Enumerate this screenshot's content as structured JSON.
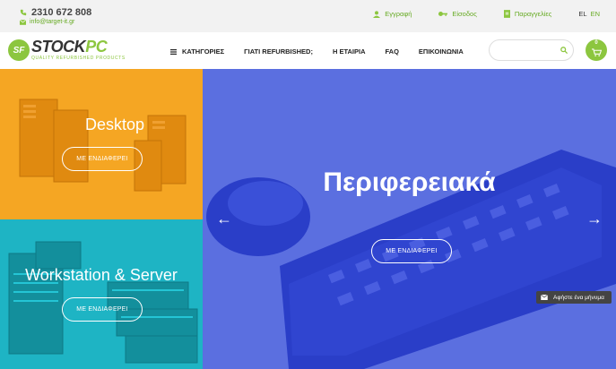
{
  "topbar": {
    "phone": "2310 672 808",
    "email": "info@target-it.gr",
    "register": "Εγγραφή",
    "login": "Είσοδος",
    "orders": "Παραγγελίες",
    "lang_el": "EL",
    "lang_en": "EN"
  },
  "logo": {
    "part1": "STOCK",
    "part2": "PC",
    "tagline": "QUALITY REFURBISHED PRODUCTS",
    "mark": "SF"
  },
  "nav": {
    "categories": "ΚΑΤΗΓΟΡΙΕΣ",
    "why": "ΓΙΑΤΙ REFURBISHED;",
    "company": "Η ΕΤΑΙΡΙΑ",
    "faq": "FAQ",
    "contact": "ΕΠΙΚΟΙΝΩΝΙΑ"
  },
  "search": {
    "placeholder": ""
  },
  "cart": {
    "count": "0"
  },
  "tiles": {
    "desktop": {
      "title": "Desktop",
      "button": "ΜΕ ΕΝΔΙΑΦΕΡΕΙ"
    },
    "workstation": {
      "title": "Workstation & Server",
      "button": "ΜΕ ΕΝΔΙΑΦΕΡΕΙ"
    },
    "peripherals": {
      "title": "Περιφερειακά",
      "button": "ΜΕ ΕΝΔΙΑΦΕΡΕΙ"
    }
  },
  "message_button": "Αφήστε ένα μήνυμα",
  "colors": {
    "accent": "#8cc63f",
    "desktop_bg": "#f5a623",
    "workstation_bg": "#1eb4c4",
    "peripherals_bg": "#5b6fe0"
  }
}
